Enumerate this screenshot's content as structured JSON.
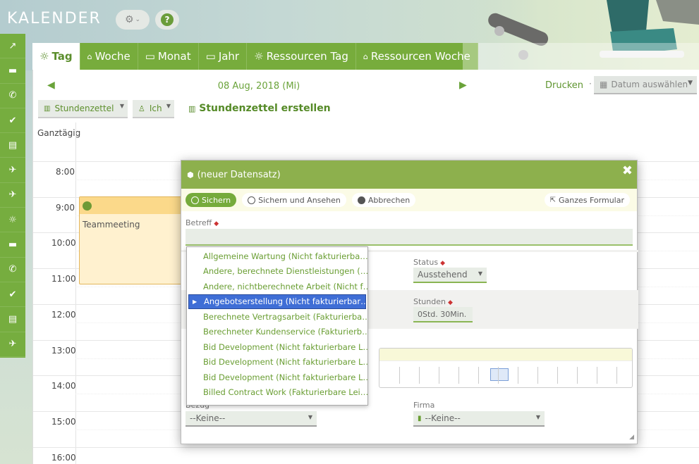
{
  "app": {
    "title": "KALENDER"
  },
  "header": {
    "settings_icon": "gear-icon",
    "help_label": "?"
  },
  "sidebar": {
    "items": [
      {
        "icon": "trend-icon"
      },
      {
        "icon": "bus-icon"
      },
      {
        "icon": "phone-icon"
      },
      {
        "icon": "check-circle-icon"
      },
      {
        "icon": "document-icon"
      },
      {
        "icon": "plane-icon"
      },
      {
        "icon": "plane-icon"
      },
      {
        "icon": "sun-icon"
      },
      {
        "icon": "bus-icon"
      },
      {
        "icon": "phone-icon"
      },
      {
        "icon": "check-circle-icon"
      },
      {
        "icon": "document-icon"
      },
      {
        "icon": "plane-icon"
      }
    ]
  },
  "tabs": [
    {
      "label": "Tag",
      "active": true
    },
    {
      "label": "Woche"
    },
    {
      "label": "Monat"
    },
    {
      "label": "Jahr"
    },
    {
      "label": "Ressourcen Tag"
    },
    {
      "label": "Ressourcen Woche"
    }
  ],
  "nav": {
    "date": "08 Aug, 2018 (Mi)",
    "print": "Drucken",
    "separator": "·",
    "date_picker": "Datum auswählen"
  },
  "toolbar": {
    "view_select": "Stundenzettel",
    "user_select": "Ich",
    "create_label": "Stundenzettel erstellen"
  },
  "calendar": {
    "allday": "Ganztägig",
    "hours": [
      "8:00",
      "9:00",
      "10:00",
      "11:00",
      "12:00",
      "13:00",
      "14:00",
      "15:00",
      "16:00"
    ],
    "event_title": "Teammeeting"
  },
  "modal": {
    "title": "(neuer Datensatz)",
    "close": "✖",
    "buttons": {
      "save": "Sichern",
      "save_view": "Sichern und Ansehen",
      "cancel": "Abbrechen",
      "full_form": "Ganzes Formular"
    },
    "fields": {
      "betreff_label": "Betreff",
      "status_label": "Status",
      "status_value": "Ausstehend",
      "stunden_label": "Stunden",
      "stunden_value": "0Std. 30Min.",
      "bezug_label": "Bezug",
      "bezug_value": "--Keine--",
      "firma_label": "Firma",
      "firma_value": "--Keine--",
      "required_mark": "◆"
    }
  },
  "dropdown": {
    "items": [
      "Allgemeine Wartung (Nicht fakturierba…",
      "Andere, berechnete Dienstleistungen (…",
      "Andere, nichtberechnete Arbeit (Nicht f…",
      "Angebotserstellung (Nicht fakturierbar…",
      "Berechnete Vertragsarbeit (Fakturierba…",
      "Berechneter Kundenservice (Fakturierb…",
      "Bid Development (Nicht fakturierbare L…",
      "Bid Development (Nicht fakturierbare L…",
      "Bid Development (Nicht fakturierbare L…",
      "Billed Contract Work (Fakturierbare Lei…"
    ],
    "selected_index": 3
  },
  "colors": {
    "accent": "#76ab3c",
    "event_bg": "#fff1cf",
    "selected": "#3f6ed6"
  }
}
